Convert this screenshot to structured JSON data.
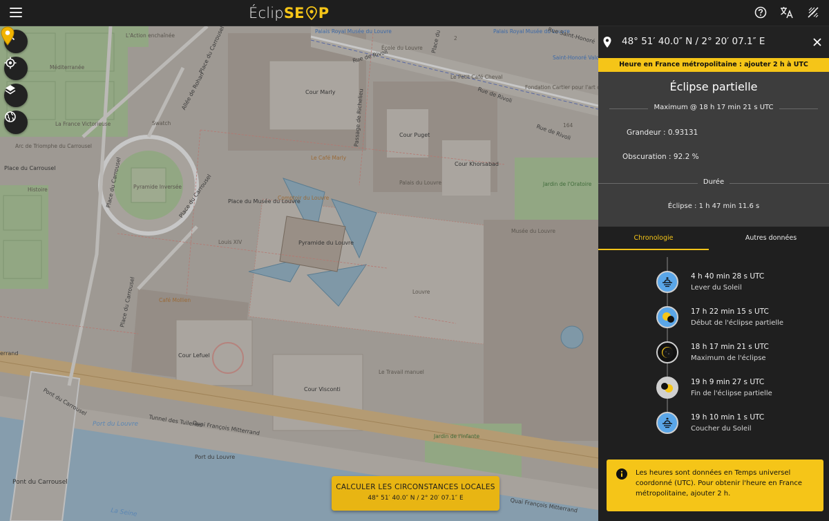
{
  "app": {
    "logo_left": "Éclip",
    "logo_right": "SE",
    "logo_end": "P"
  },
  "map": {
    "labels": {
      "palais_royal": "Palais Royal Musée du Louvre",
      "palais_royal_top": "Palais Royal Musée du Louvre",
      "cour_marly": "Cour Marly",
      "cour_puget": "Cour Puget",
      "cour_khorsabad": "Cour Khorsabad",
      "place_musee": "Place du Musée du Louvre",
      "pyramide": "Pyramide du Louvre",
      "pyramide_inversee": "Pyramide Inversée",
      "louis_xiv": "Louis XIV",
      "louvre": "Louvre",
      "cour_lefuel": "Cour Lefuel",
      "cour_visconti": "Cour Visconti",
      "le_travail": "Le Travail manuel",
      "jardin_oratoire": "Jardin de l'Oratoire",
      "jardin_infante": "Jardin de l'Infante",
      "arc_triomphe": "Arc de Triomphe du Carrousel",
      "place_carrousel": "Place du Carrousel",
      "histoire": "Histoire",
      "mediterranee": "Méditerranée",
      "la_france": "La France Victorieuse",
      "action": "L'Action enchaînée",
      "swatch": "Swatch",
      "ecole": "École du Louvre",
      "petit_cafe": "Le Petit Café Cheval",
      "saint_honore": "Saint-Honoré Valois",
      "fondation": "Fondation Cartier pour l'art contemporain",
      "palais_louvre": "Palais du Louvre",
      "musee_louvre": "Musée du Louvre",
      "le_cafe_marly": "Le Café Marly",
      "comptoir": "Comptoir du Louvre",
      "cafe_mollien": "Café Mollien",
      "port_louvre": "Port du Louvre",
      "port_louvre_2": "Port du Louvre",
      "pont_carrousel": "Pont du Carrousel",
      "la_seine": "La Seine",
      "num_164": "164",
      "num_2": "2"
    },
    "streets": {
      "rue_rivoli": "Rue de Rivoli",
      "rue_rivoli_2": "Rue de Rivoli",
      "rue_rivoli_3": "Rue de Rivoli",
      "rue_saint_honore": "Rue Saint-Honoré",
      "allee_rohan": "Allée de Rohan",
      "place_carrousel_st": "Place du Carrousel",
      "place_carrousel_st2": "Place du Carrousel",
      "place_carrousel_st3": "Place du Carrousel",
      "passage_richelieu": "Passage de Richelieu",
      "tunnel": "Tunnel des Tuileries",
      "quai_mitterrand": "Quai François Mitterrand",
      "quai_mitterrand_2": "Quai François Mitterrand",
      "pont_carrousel_st": "Pont du Carrousel",
      "place_du": "Place du",
      "errand": "errand",
      "place_du_carrousel_v": "Place du Carrousel"
    },
    "calc_button": {
      "title": "CALCULER LES CIRCONSTANCES LOCALES",
      "coords": "48° 51′ 40.0″ N / 2° 20′ 07.1″ E"
    }
  },
  "panel": {
    "coords": "48° 51′ 40.0″ N / 2° 20′ 07.1″ E",
    "tz_banner": "Heure en France métropolitaine : ajouter 2 h à UTC",
    "title": "Éclipse partielle",
    "maximum": "Maximum @ 18 h 17 min 21 s UTC",
    "grandeur": "Grandeur : 0.93131",
    "obscuration": "Obscuration : 92.2 %",
    "duree_heading": "Durée",
    "eclipse_duration": "Éclipse : 1 h 47 min 11.6 s",
    "tabs": [
      {
        "label": "Chronologie"
      },
      {
        "label": "Autres données"
      }
    ],
    "timeline": [
      {
        "time": "4 h 40 min 28 s UTC",
        "desc": "Lever du Soleil",
        "icon": "sunrise-icon"
      },
      {
        "time": "17 h 22 min 15 s UTC",
        "desc": "Début de l'éclipse partielle",
        "icon": "eclipse-start-icon"
      },
      {
        "time": "18 h 17 min 21 s UTC",
        "desc": "Maximum de l'éclipse",
        "icon": "eclipse-maximum-icon"
      },
      {
        "time": "19 h 9 min 27 s UTC",
        "desc": "Fin de l'éclipse partielle",
        "icon": "eclipse-end-icon"
      },
      {
        "time": "19 h 10 min 1 s UTC",
        "desc": "Coucher du Soleil",
        "icon": "sunset-icon"
      }
    ],
    "note": "Les heures sont données en Temps universel coordonné (UTC). Pour obtenir l'heure en France métropolitaine, ajouter 2 h."
  },
  "colors": {
    "accent": "#f5c518",
    "panel_bg": "#1f1f1f",
    "info_bg": "#3d3d3d",
    "timeline_blue": "#5aa6e8"
  }
}
